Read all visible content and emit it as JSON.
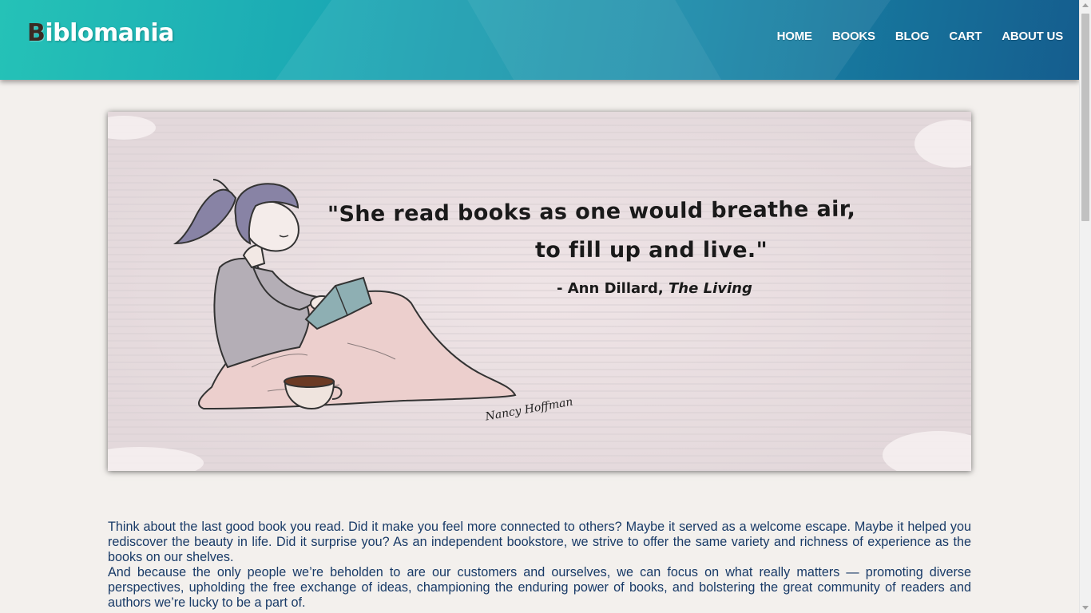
{
  "header": {
    "logo_initial": "B",
    "logo_rest": "iblomania",
    "nav": [
      {
        "label": "HOME"
      },
      {
        "label": "BOOKS"
      },
      {
        "label": "BLOG"
      },
      {
        "label": "CART"
      },
      {
        "label": "ABOUT US"
      }
    ]
  },
  "hero": {
    "quote_line1": "\"She read books as one would breathe air,",
    "quote_line2": "to fill up and live.\"",
    "attribution_prefix": "- Ann Dillard, ",
    "attribution_work": "The Living",
    "artist_signature": "Nancy Hoffman"
  },
  "content": {
    "paragraphs": [
      "Think about the last good book you read. Did it make you feel more connected to others? Maybe it served as a welcome escape. Maybe it helped you rediscover the beauty in life. Did it surprise you? As an independent bookstore, we strive to offer the same variety and richness of experience as the books on our shelves.",
      "And because the only people we’re beholden to are our customers and ourselves, we can focus on what really matters — promoting diverse perspectives, upholding the free exchange of ideas, championing the enduring power of books, and bolstering the great community of readers and authors we’re lucky to be a part of."
    ]
  },
  "colors": {
    "header_gradient_start": "#25c2b7",
    "header_gradient_end": "#155d8e",
    "body_text": "#183a67",
    "page_background": "#f3f0ed"
  }
}
